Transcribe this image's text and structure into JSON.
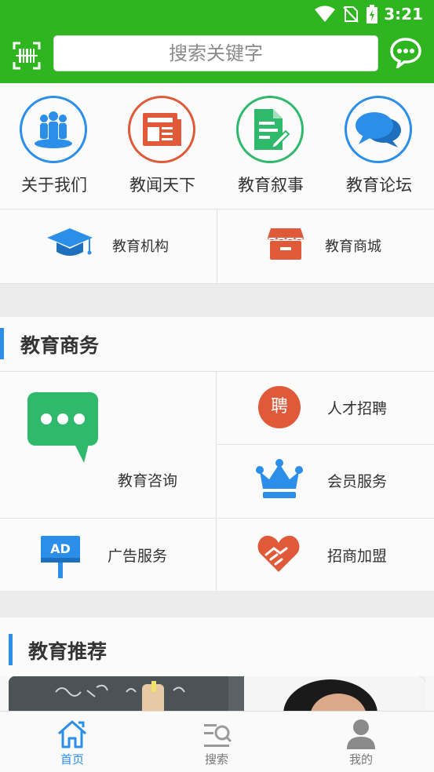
{
  "status_bar": {
    "time": "3:21"
  },
  "header": {
    "search_placeholder": "搜索关键字"
  },
  "top_menu": [
    {
      "label": "关于我们",
      "icon": "people-group-icon",
      "color": "#2b8ee8"
    },
    {
      "label": "教闻天下",
      "icon": "newspaper-icon",
      "color": "#e05a3a"
    },
    {
      "label": "教育叙事",
      "icon": "document-edit-icon",
      "color": "#2fb96b"
    },
    {
      "label": "教育论坛",
      "icon": "chat-bubbles-icon",
      "color": "#2b8ee8"
    }
  ],
  "second_row": [
    {
      "label": "教育机构",
      "icon": "graduation-cap-icon"
    },
    {
      "label": "教育商城",
      "icon": "shop-icon"
    }
  ],
  "business_section": {
    "title": "教育商务",
    "items": [
      {
        "label": "教育咨询",
        "icon": "message-icon"
      },
      {
        "label": "人才招聘",
        "icon": "recruit-icon",
        "badge": "聘"
      },
      {
        "label": "会员服务",
        "icon": "crown-icon"
      },
      {
        "label": "广告服务",
        "icon": "ad-board-icon",
        "badge": "AD"
      },
      {
        "label": "招商加盟",
        "icon": "handshake-icon"
      }
    ]
  },
  "recommend_section": {
    "title": "教育推荐"
  },
  "bottom_nav": [
    {
      "label": "首页",
      "icon": "home-icon",
      "active": true
    },
    {
      "label": "搜索",
      "icon": "search-list-icon",
      "active": false
    },
    {
      "label": "我的",
      "icon": "user-icon",
      "active": false
    }
  ],
  "colors": {
    "primary_green": "#2fb51f",
    "accent_blue": "#2b8ee8",
    "accent_orange": "#e05a3a"
  }
}
